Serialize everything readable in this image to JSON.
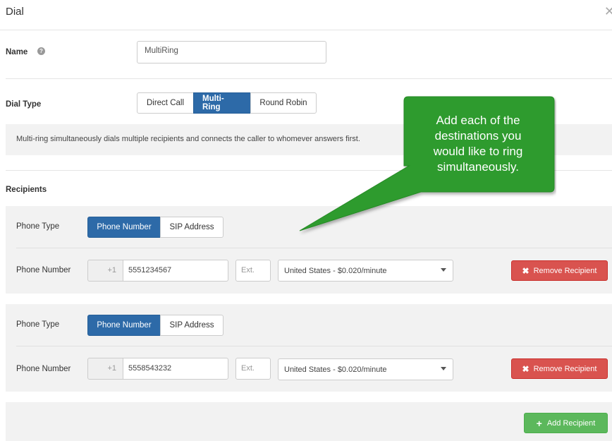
{
  "dialog": {
    "title": "Dial",
    "close_icon": "close-icon"
  },
  "name_field": {
    "label": "Name",
    "help_icon": "question-circle-icon",
    "value": "MultiRing"
  },
  "dial_type": {
    "label": "Dial Type",
    "options": [
      "Direct Call",
      "Multi-Ring",
      "Round Robin"
    ],
    "selected": "Multi-Ring",
    "description": "Multi-ring simultaneously dials multiple recipients and connects the caller to whomever answers first."
  },
  "recipients": {
    "label": "Recipients",
    "items": [
      {
        "phone_type_label": "Phone Type",
        "phone_type_options": [
          "Phone Number",
          "SIP Address"
        ],
        "phone_type_selected": "Phone Number",
        "phone_number_label": "Phone Number",
        "country_code": "+1",
        "number": "5551234567",
        "ext_placeholder": "Ext.",
        "rate": "United States - $0.020/minute",
        "remove_label": "Remove Recipient"
      },
      {
        "phone_type_label": "Phone Type",
        "phone_type_options": [
          "Phone Number",
          "SIP Address"
        ],
        "phone_type_selected": "Phone Number",
        "phone_number_label": "Phone Number",
        "country_code": "+1",
        "number": "5558543232",
        "ext_placeholder": "Ext.",
        "rate": "United States - $0.020/minute",
        "remove_label": "Remove Recipient"
      }
    ],
    "add_label": "Add Recipient"
  },
  "callout": {
    "lines": [
      "Add each of the",
      "destinations you",
      "would like to ring",
      "simultaneously."
    ]
  },
  "colors": {
    "primary": "#2d6aa8",
    "danger": "#d9534f",
    "success": "#5cb85c",
    "callout": "#2e9b2e"
  }
}
